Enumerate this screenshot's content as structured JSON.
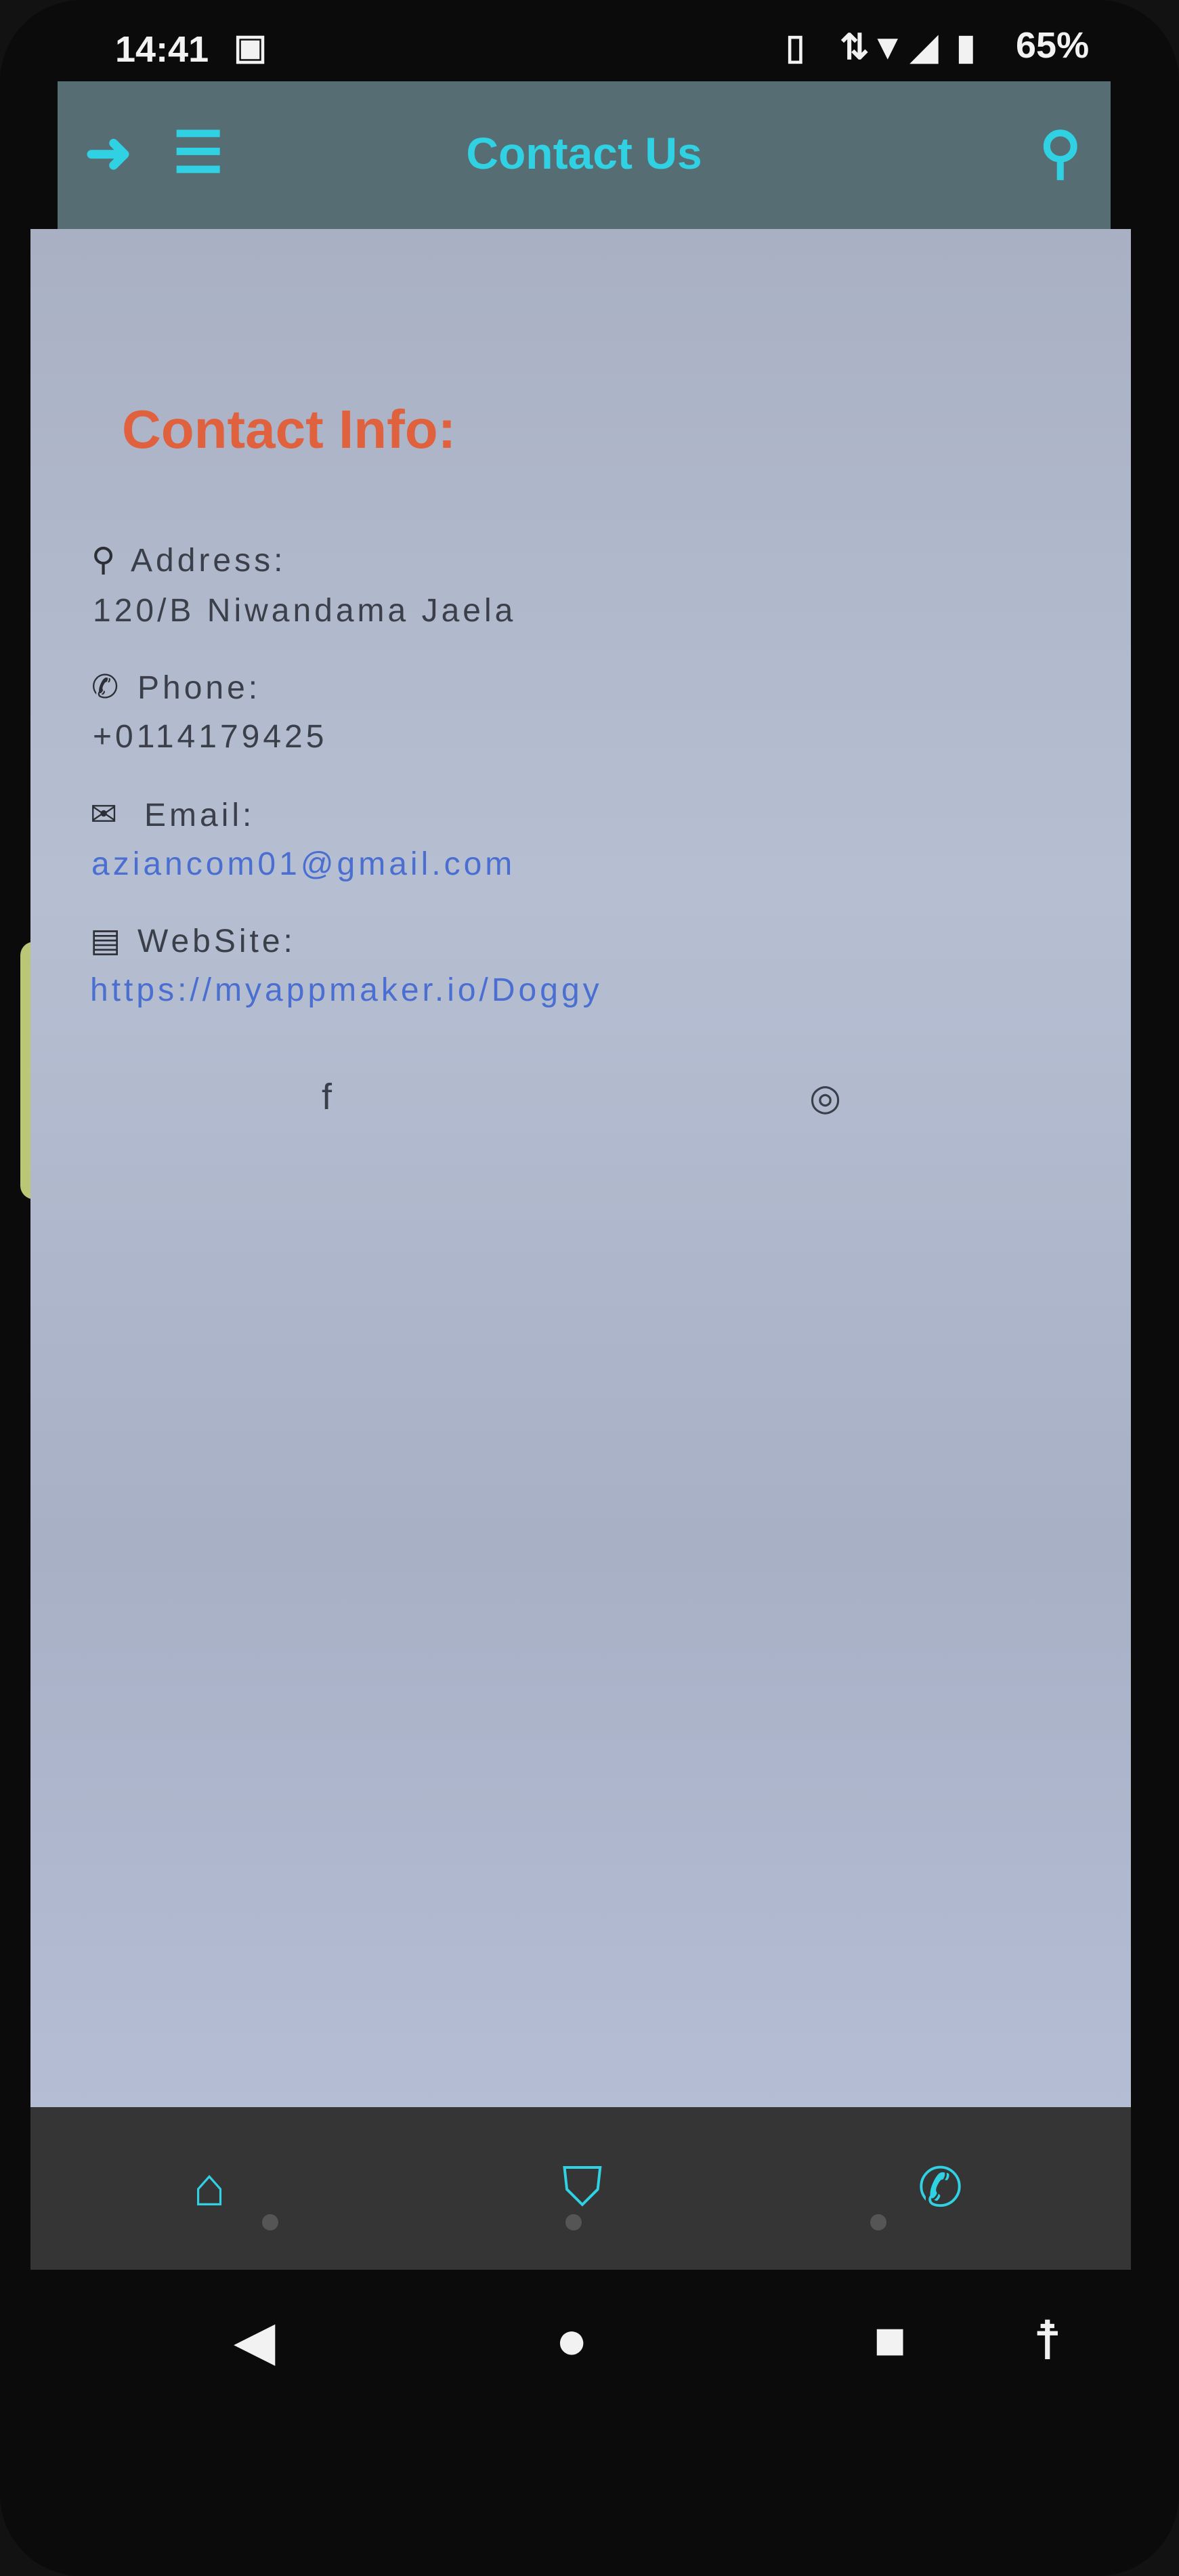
{
  "status_bar": {
    "time": "14:41",
    "battery": "65%"
  },
  "app_bar": {
    "title": "Contact Us"
  },
  "contact": {
    "heading": "Contact Info:",
    "address_label": "Address:",
    "address_value": "120/B Niwandama Jaela",
    "phone_label": "Phone:",
    "phone_value": "+0114179425",
    "email_label": "Email:",
    "email_value": "aziancom01@gmail.com",
    "website_label": "WebSite:",
    "website_value": "https://myappmaker.io/Doggy"
  },
  "colors": {
    "accent": "#2fd1e2",
    "heading": "#e0613d",
    "link": "#4a6fd1",
    "app_bar_bg": "#566e73",
    "bottom_nav_bg": "#353535"
  },
  "icons": {
    "back": "arrow-left-icon",
    "menu": "hamburger-menu-icon",
    "search": "search-icon",
    "address": "map-pin-icon",
    "phone": "phone-icon",
    "email": "envelope-icon",
    "website": "document-icon",
    "facebook": "facebook-icon",
    "instagram": "instagram-icon",
    "nav_home": "home-icon",
    "nav_badge": "shield-badge-icon",
    "nav_phone": "phone-icon"
  }
}
